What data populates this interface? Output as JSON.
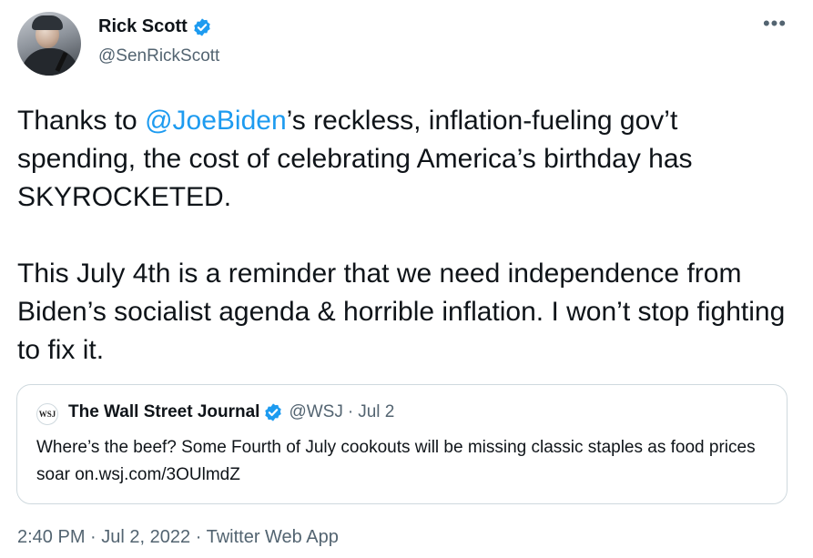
{
  "author": {
    "name": "Rick Scott",
    "handle": "@SenRickScott"
  },
  "more_icon_glyph": "•••",
  "tweet": {
    "pre_mention": "Thanks to ",
    "mention": "@JoeBiden",
    "post_mention": "’s reckless, inflation-fueling gov’t spending, the cost of celebrating America’s birthday has SKYROCKETED.\n\nThis July 4th is a reminder that we need independence from Biden’s socialist agenda & horrible inflation. I won’t stop fighting to fix it."
  },
  "quote": {
    "logo_text": "WSJ",
    "name": "The Wall Street Journal",
    "handle": "@WSJ",
    "separator": "·",
    "date": "Jul 2",
    "text": "Where’s the beef? Some Fourth of July cookouts will be missing classic staples as food prices soar on.wsj.com/3OUlmdZ"
  },
  "footer": {
    "time": "2:40 PM",
    "date": "Jul 2, 2022",
    "source": "Twitter Web App",
    "separator": "·"
  },
  "colors": {
    "accent": "#1d9bf0",
    "text": "#0f1419",
    "muted": "#536471",
    "border": "#cfd9de"
  }
}
